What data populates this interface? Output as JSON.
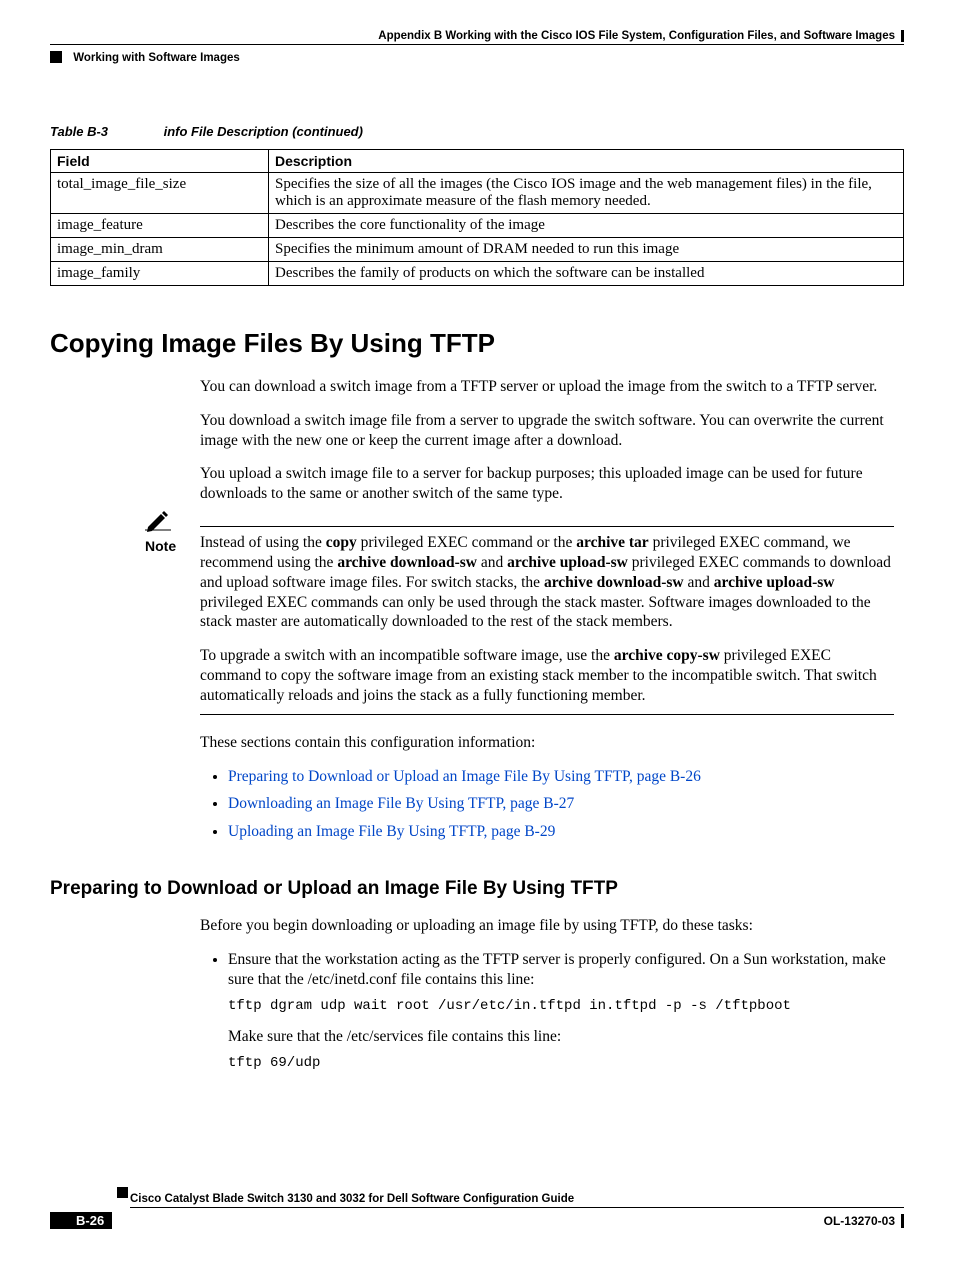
{
  "header": {
    "appendix": "Appendix B      Working with the Cisco IOS File System, Configuration Files, and Software Images",
    "section": "Working with Software Images"
  },
  "table": {
    "caption_num": "Table B-3",
    "caption_title": "info File Description (continued)",
    "headers": {
      "field": "Field",
      "desc": "Description"
    },
    "rows": [
      {
        "field": "total_image_file_size",
        "desc": "Specifies the size of all the images (the Cisco IOS image and the web management files) in the file, which is an approximate measure of the flash memory needed."
      },
      {
        "field": "image_feature",
        "desc": "Describes the core functionality of the image"
      },
      {
        "field": "image_min_dram",
        "desc": "Specifies the minimum amount of DRAM needed to run this image"
      },
      {
        "field": "image_family",
        "desc": "Describes the family of products on which the software can be installed"
      }
    ]
  },
  "h1": "Copying Image Files By Using TFTP",
  "para1": "You can download a switch image from a TFTP server or upload the image from the switch to a TFTP server.",
  "para2": "You download a switch image file from a server to upgrade the switch software. You can overwrite the current image with the new one or keep the current image after a download.",
  "para3": "You upload a switch image file to a server for backup purposes; this uploaded image can be used for future downloads to the same or another switch of the same type.",
  "note": {
    "label": "Note",
    "p1_pre": "Instead of using the ",
    "p1_b1": "copy",
    "p1_mid1": " privileged EXEC command or the ",
    "p1_b2": "archive tar",
    "p1_mid2": " privileged EXEC command, we recommend using the ",
    "p1_b3": "archive download-sw",
    "p1_mid3": " and ",
    "p1_b4": "archive upload-sw",
    "p1_mid4": " privileged EXEC commands to download and upload software image files. For switch stacks, the ",
    "p1_b5": "archive download-sw",
    "p1_mid5": " and ",
    "p1_b6": "archive upload-sw",
    "p1_end": " privileged EXEC commands can only be used through the stack master. Software images downloaded to the stack master are automatically downloaded to the rest of the stack members.",
    "p2_pre": "To upgrade a switch with an incompatible software image, use the ",
    "p2_b1": "archive copy-sw",
    "p2_end": " privileged EXEC command to copy the software image from an existing stack member to the incompatible switch. That switch automatically reloads and joins the stack as a fully functioning member."
  },
  "para4": "These sections contain this configuration information:",
  "links": [
    "Preparing to Download or Upload an Image File By Using TFTP, page B-26",
    "Downloading an Image File By Using TFTP, page B-27",
    "Uploading an Image File By Using TFTP, page B-29"
  ],
  "h2": "Preparing to Download or Upload an Image File By Using TFTP",
  "para5": "Before you begin downloading or uploading an image file by using TFTP, do these tasks:",
  "step1": "Ensure that the workstation acting as the TFTP server is properly configured. On a Sun workstation, make sure that the /etc/inetd.conf file contains this line:",
  "code1": "tftp dgram udp wait root /usr/etc/in.tftpd in.tftpd -p -s /tftpboot",
  "step1b": "Make sure that the /etc/services file contains this line:",
  "code2": "tftp 69/udp",
  "footer": {
    "title": "Cisco Catalyst Blade Switch 3130 and 3032 for Dell Software Configuration Guide",
    "page": "B-26",
    "doc": "OL-13270-03"
  }
}
